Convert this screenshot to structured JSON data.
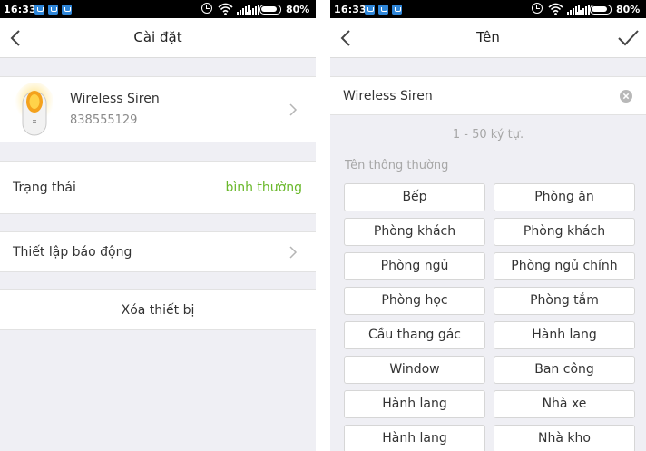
{
  "status_bar": {
    "time": "16:33",
    "battery": "80%",
    "icons": [
      "notification-icon",
      "notification-icon",
      "notification-icon",
      "alarm-icon",
      "wifi-icon",
      "signal-icon",
      "signal-icon",
      "battery-icon"
    ]
  },
  "left_screen": {
    "header": {
      "title": "Cài đặt",
      "back_icon": "chevron-left-icon"
    },
    "device": {
      "name": "Wireless Siren",
      "id": "838555129",
      "icon": "siren-device-icon",
      "chevron": "chevron-right-icon"
    },
    "status": {
      "label": "Trạng thái",
      "value": "bình thường",
      "value_color": "#6ab82b"
    },
    "alarm_settings": {
      "label": "Thiết lập báo động",
      "chevron": "chevron-right-icon"
    },
    "delete_device": {
      "label": "Xóa thiết bị"
    }
  },
  "right_screen": {
    "header": {
      "title": "Tên",
      "back_icon": "chevron-left-icon",
      "confirm_icon": "checkmark-icon"
    },
    "name_input": {
      "value": "Wireless Siren",
      "clear_icon": "clear-icon"
    },
    "char_hint": "1 - 50 ký tự.",
    "section_label": "Tên thông thường",
    "presets": [
      "Bếp",
      "Phòng ăn",
      "Phòng khách",
      "Phòng khách",
      "Phòng ngủ",
      "Phòng ngủ chính",
      "Phòng học",
      "Phòng tắm",
      "Cầu thang gác",
      "Hành lang",
      "Window",
      "Ban công",
      "Hành lang",
      "Nhà xe",
      "Hành lang",
      "Nhà kho"
    ]
  }
}
